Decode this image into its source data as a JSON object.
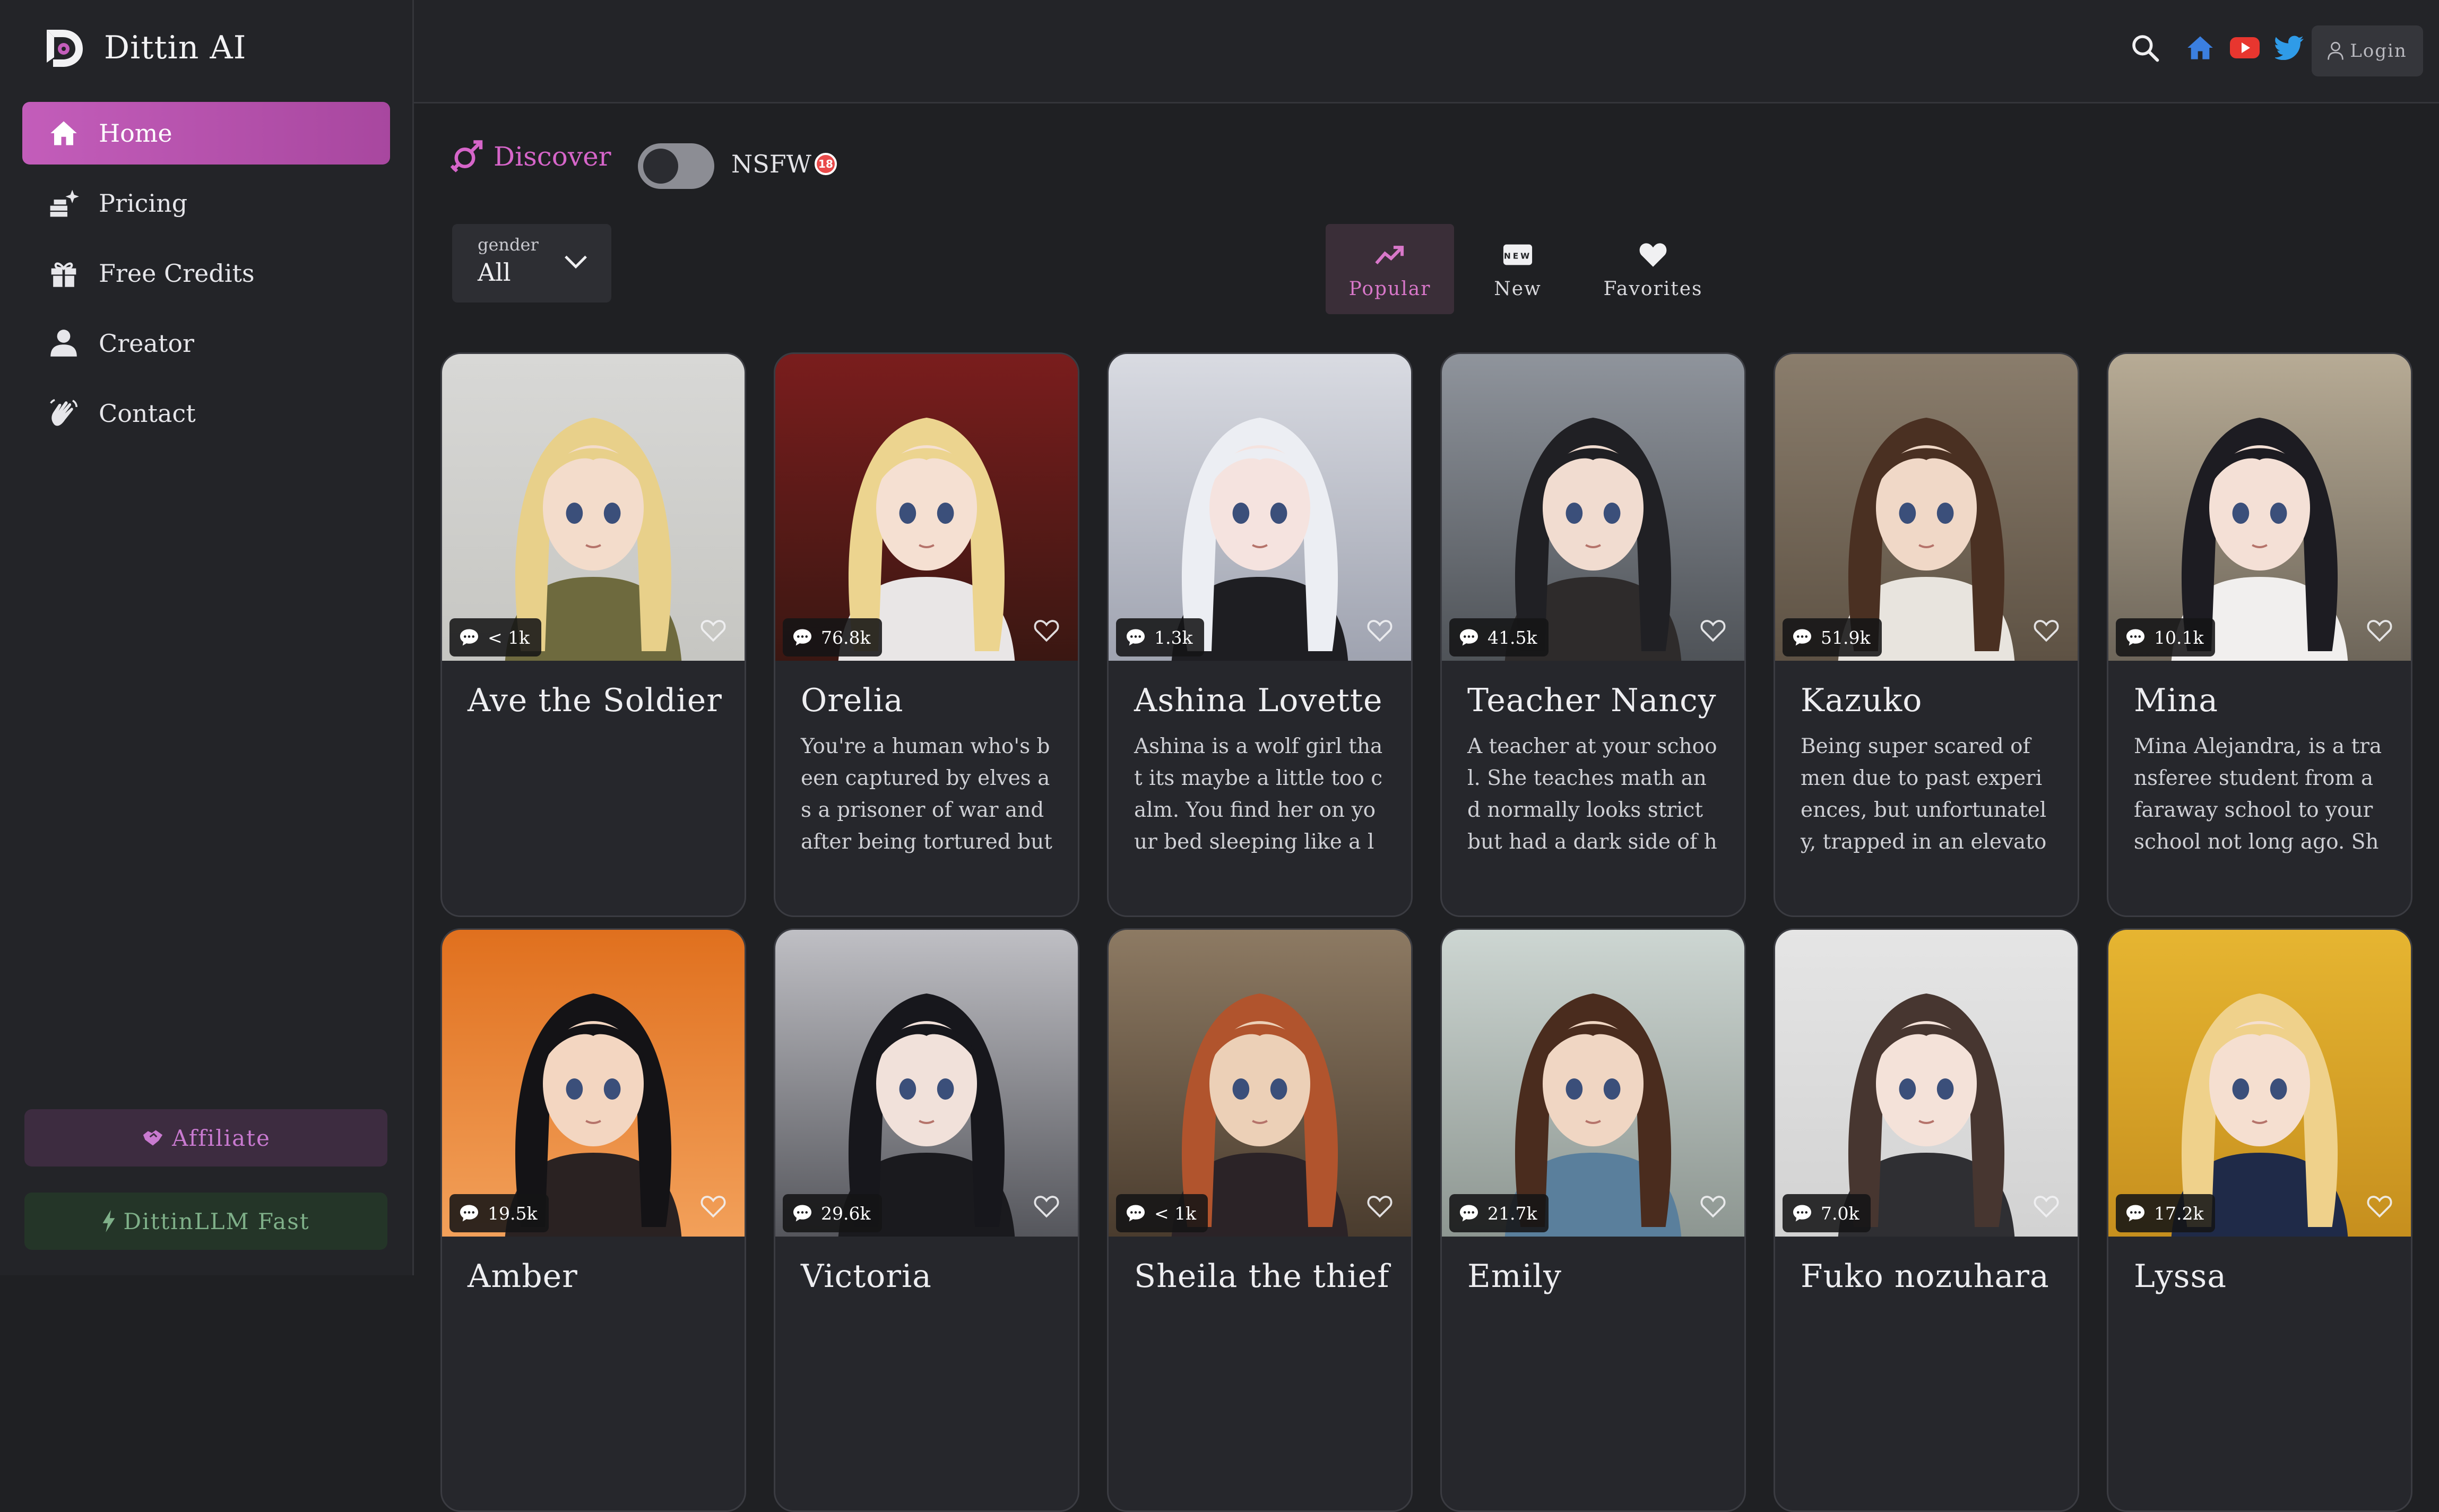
{
  "app": {
    "name": "Dittin AI"
  },
  "sidebar": {
    "items": [
      {
        "label": "Home",
        "icon": "home-icon",
        "active": true
      },
      {
        "label": "Pricing",
        "icon": "pricing-icon",
        "active": false
      },
      {
        "label": "Free Credits",
        "icon": "gift-icon",
        "active": false
      },
      {
        "label": "Creator",
        "icon": "user-icon",
        "active": false
      },
      {
        "label": "Contact",
        "icon": "wave-hand-icon",
        "active": false
      }
    ],
    "affiliate_label": "Affiliate",
    "llm_label": "DittinLLM Fast"
  },
  "header": {
    "login_label": "Login",
    "icons": [
      "search-icon",
      "home-icon",
      "youtube-icon",
      "twitter-icon",
      "discord-icon"
    ]
  },
  "discover": {
    "label": "Discover",
    "nsfw_label": "NSFW",
    "nsfw_badge": "18",
    "nsfw_enabled": false
  },
  "filters": {
    "gender_label": "gender",
    "gender_value": "All",
    "tabs": [
      {
        "label": "Popular",
        "icon": "trending-icon",
        "active": true
      },
      {
        "label": "New",
        "icon": "new-badge-icon",
        "active": false
      },
      {
        "label": "Favorites",
        "icon": "heart-icon",
        "active": false
      }
    ],
    "new_icon_text": "NEW"
  },
  "cards": [
    {
      "name": "Ave the Soldier",
      "count": "< 1k",
      "desc": ""
    },
    {
      "name": "Orelia",
      "count": "76.8k",
      "desc": "You're a human who's been captured by elves as a prisoner of war and after being tortured but still ..."
    },
    {
      "name": "Ashina Lovette",
      "count": "1.3k",
      "desc": "Ashina is a wolf girl that its maybe a little too calm. You find her on your bed sleeping like a log..."
    },
    {
      "name": "Teacher Nancy",
      "count": "41.5k",
      "desc": "A teacher at your school. She teaches math and normally looks strict but had a dark side of herself ..."
    },
    {
      "name": "Kazuko",
      "count": "51.9k",
      "desc": "Being super scared of men due to past experiences, but unfortunately, trapped in an elevator with yo..."
    },
    {
      "name": "Mina",
      "count": "10.1k",
      "desc": "Mina Alejandra, is a transferee student from a faraway school to your school not long ago. She has a..."
    },
    {
      "name": "Amber",
      "count": "19.5k",
      "desc": ""
    },
    {
      "name": "Victoria",
      "count": "29.6k",
      "desc": ""
    },
    {
      "name": "Sheila the thief",
      "count": "< 1k",
      "desc": ""
    },
    {
      "name": "Emily",
      "count": "21.7k",
      "desc": ""
    },
    {
      "name": "Fuko nozuhara",
      "count": "7.0k",
      "desc": ""
    },
    {
      "name": "Lyssa",
      "count": "17.2k",
      "desc": ""
    }
  ],
  "colors": {
    "accent": "#c35dba",
    "background": "#1f2023",
    "sidebar": "#232428",
    "card": "#26272c"
  }
}
